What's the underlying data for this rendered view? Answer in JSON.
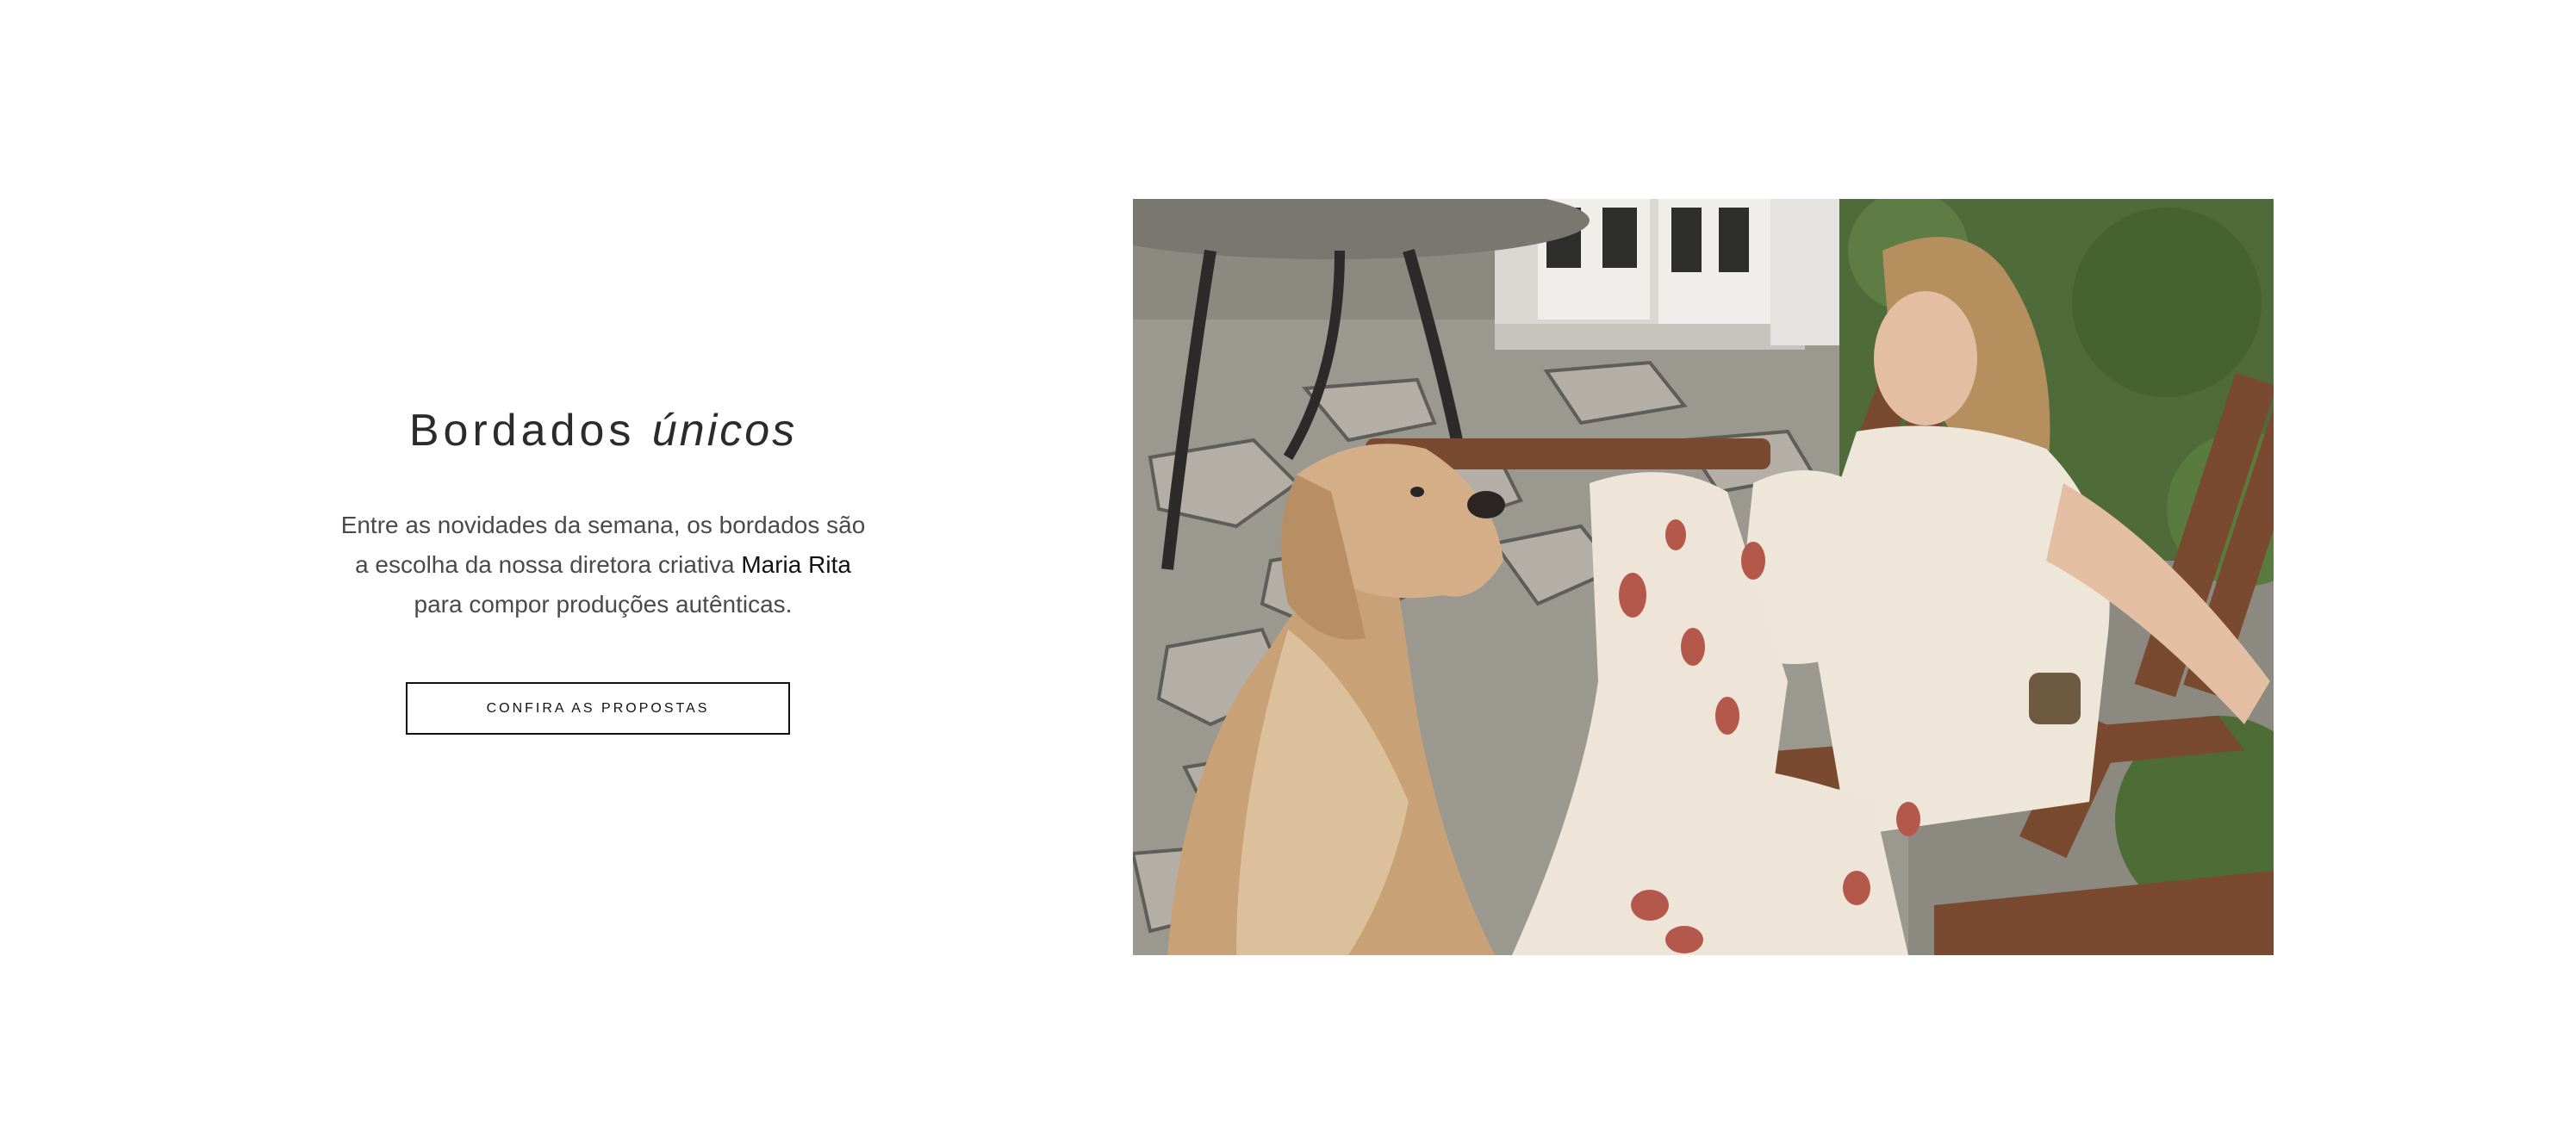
{
  "feature": {
    "title_regular": "Bordados",
    "title_italic": "únicos",
    "description": {
      "line1": "Entre as novidades da semana, os bordados são",
      "line2_prefix": "a escolha da nossa diretora criativa",
      "highlight": "Maria Rita",
      "line3": "para compor produções autênticas."
    },
    "cta_label": "CONFIRA AS PROPOSTAS"
  },
  "image": {
    "alt": "Mulher sentada em cadeira de madeira com um cachorro golden retriever"
  }
}
